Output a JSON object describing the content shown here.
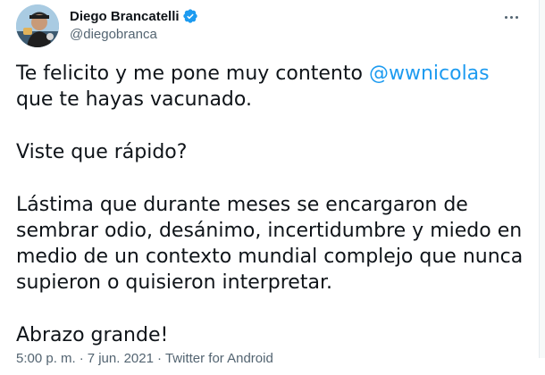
{
  "tweet": {
    "author": {
      "display_name": "Diego Brancatelli",
      "handle": "@diegobranca",
      "verified": true
    },
    "body": {
      "p1_before": "Te felicito y me pone muy contento ",
      "p1_mention": "@wwnicolas",
      "p1_after": " que te hayas vacunado.",
      "p2": "Viste que rápido?",
      "p3": "Lástima que durante meses se encargaron de sembrar odio, desánimo, incertidumbre y miedo en medio de un contexto mundial complejo que nunca supieron o quisieron interpretar.",
      "p4": "Abrazo grande!"
    },
    "meta": {
      "time": "5:00 p. m.",
      "date": "7 jun. 2021",
      "source": "Twitter for Android"
    }
  },
  "colors": {
    "text": "#0f1419",
    "secondary": "#536471",
    "accent": "#1d9bf0"
  },
  "icons": {
    "verified": "verified-badge-icon",
    "more": "more-options-icon"
  }
}
